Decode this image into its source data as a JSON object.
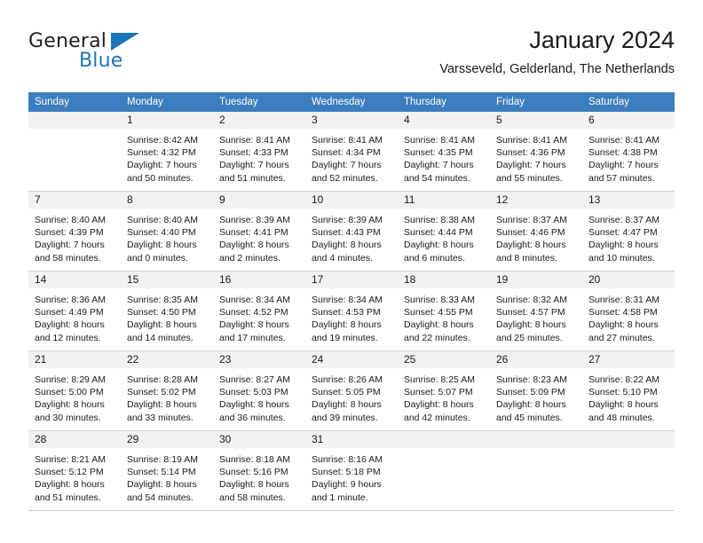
{
  "brand": {
    "name_part1": "General",
    "name_part2": "Blue",
    "triangle_icon": "triangle-icon",
    "accent_color": "#1b75bb"
  },
  "header": {
    "title": "January 2024",
    "subtitle": "Varsseveld, Gelderland, The Netherlands"
  },
  "calendar": {
    "header_bg": "#3b7dbf",
    "daynum_bg": "#f2f2f2",
    "weekdays": [
      "Sunday",
      "Monday",
      "Tuesday",
      "Wednesday",
      "Thursday",
      "Friday",
      "Saturday"
    ],
    "weeks": [
      [
        {
          "day": "",
          "lines": []
        },
        {
          "day": "1",
          "lines": [
            "Sunrise: 8:42 AM",
            "Sunset: 4:32 PM",
            "Daylight: 7 hours",
            "and 50 minutes."
          ]
        },
        {
          "day": "2",
          "lines": [
            "Sunrise: 8:41 AM",
            "Sunset: 4:33 PM",
            "Daylight: 7 hours",
            "and 51 minutes."
          ]
        },
        {
          "day": "3",
          "lines": [
            "Sunrise: 8:41 AM",
            "Sunset: 4:34 PM",
            "Daylight: 7 hours",
            "and 52 minutes."
          ]
        },
        {
          "day": "4",
          "lines": [
            "Sunrise: 8:41 AM",
            "Sunset: 4:35 PM",
            "Daylight: 7 hours",
            "and 54 minutes."
          ]
        },
        {
          "day": "5",
          "lines": [
            "Sunrise: 8:41 AM",
            "Sunset: 4:36 PM",
            "Daylight: 7 hours",
            "and 55 minutes."
          ]
        },
        {
          "day": "6",
          "lines": [
            "Sunrise: 8:41 AM",
            "Sunset: 4:38 PM",
            "Daylight: 7 hours",
            "and 57 minutes."
          ]
        }
      ],
      [
        {
          "day": "7",
          "lines": [
            "Sunrise: 8:40 AM",
            "Sunset: 4:39 PM",
            "Daylight: 7 hours",
            "and 58 minutes."
          ]
        },
        {
          "day": "8",
          "lines": [
            "Sunrise: 8:40 AM",
            "Sunset: 4:40 PM",
            "Daylight: 8 hours",
            "and 0 minutes."
          ]
        },
        {
          "day": "9",
          "lines": [
            "Sunrise: 8:39 AM",
            "Sunset: 4:41 PM",
            "Daylight: 8 hours",
            "and 2 minutes."
          ]
        },
        {
          "day": "10",
          "lines": [
            "Sunrise: 8:39 AM",
            "Sunset: 4:43 PM",
            "Daylight: 8 hours",
            "and 4 minutes."
          ]
        },
        {
          "day": "11",
          "lines": [
            "Sunrise: 8:38 AM",
            "Sunset: 4:44 PM",
            "Daylight: 8 hours",
            "and 6 minutes."
          ]
        },
        {
          "day": "12",
          "lines": [
            "Sunrise: 8:37 AM",
            "Sunset: 4:46 PM",
            "Daylight: 8 hours",
            "and 8 minutes."
          ]
        },
        {
          "day": "13",
          "lines": [
            "Sunrise: 8:37 AM",
            "Sunset: 4:47 PM",
            "Daylight: 8 hours",
            "and 10 minutes."
          ]
        }
      ],
      [
        {
          "day": "14",
          "lines": [
            "Sunrise: 8:36 AM",
            "Sunset: 4:49 PM",
            "Daylight: 8 hours",
            "and 12 minutes."
          ]
        },
        {
          "day": "15",
          "lines": [
            "Sunrise: 8:35 AM",
            "Sunset: 4:50 PM",
            "Daylight: 8 hours",
            "and 14 minutes."
          ]
        },
        {
          "day": "16",
          "lines": [
            "Sunrise: 8:34 AM",
            "Sunset: 4:52 PM",
            "Daylight: 8 hours",
            "and 17 minutes."
          ]
        },
        {
          "day": "17",
          "lines": [
            "Sunrise: 8:34 AM",
            "Sunset: 4:53 PM",
            "Daylight: 8 hours",
            "and 19 minutes."
          ]
        },
        {
          "day": "18",
          "lines": [
            "Sunrise: 8:33 AM",
            "Sunset: 4:55 PM",
            "Daylight: 8 hours",
            "and 22 minutes."
          ]
        },
        {
          "day": "19",
          "lines": [
            "Sunrise: 8:32 AM",
            "Sunset: 4:57 PM",
            "Daylight: 8 hours",
            "and 25 minutes."
          ]
        },
        {
          "day": "20",
          "lines": [
            "Sunrise: 8:31 AM",
            "Sunset: 4:58 PM",
            "Daylight: 8 hours",
            "and 27 minutes."
          ]
        }
      ],
      [
        {
          "day": "21",
          "lines": [
            "Sunrise: 8:29 AM",
            "Sunset: 5:00 PM",
            "Daylight: 8 hours",
            "and 30 minutes."
          ]
        },
        {
          "day": "22",
          "lines": [
            "Sunrise: 8:28 AM",
            "Sunset: 5:02 PM",
            "Daylight: 8 hours",
            "and 33 minutes."
          ]
        },
        {
          "day": "23",
          "lines": [
            "Sunrise: 8:27 AM",
            "Sunset: 5:03 PM",
            "Daylight: 8 hours",
            "and 36 minutes."
          ]
        },
        {
          "day": "24",
          "lines": [
            "Sunrise: 8:26 AM",
            "Sunset: 5:05 PM",
            "Daylight: 8 hours",
            "and 39 minutes."
          ]
        },
        {
          "day": "25",
          "lines": [
            "Sunrise: 8:25 AM",
            "Sunset: 5:07 PM",
            "Daylight: 8 hours",
            "and 42 minutes."
          ]
        },
        {
          "day": "26",
          "lines": [
            "Sunrise: 8:23 AM",
            "Sunset: 5:09 PM",
            "Daylight: 8 hours",
            "and 45 minutes."
          ]
        },
        {
          "day": "27",
          "lines": [
            "Sunrise: 8:22 AM",
            "Sunset: 5:10 PM",
            "Daylight: 8 hours",
            "and 48 minutes."
          ]
        }
      ],
      [
        {
          "day": "28",
          "lines": [
            "Sunrise: 8:21 AM",
            "Sunset: 5:12 PM",
            "Daylight: 8 hours",
            "and 51 minutes."
          ]
        },
        {
          "day": "29",
          "lines": [
            "Sunrise: 8:19 AM",
            "Sunset: 5:14 PM",
            "Daylight: 8 hours",
            "and 54 minutes."
          ]
        },
        {
          "day": "30",
          "lines": [
            "Sunrise: 8:18 AM",
            "Sunset: 5:16 PM",
            "Daylight: 8 hours",
            "and 58 minutes."
          ]
        },
        {
          "day": "31",
          "lines": [
            "Sunrise: 8:16 AM",
            "Sunset: 5:18 PM",
            "Daylight: 9 hours",
            "and 1 minute."
          ]
        },
        {
          "day": "",
          "lines": []
        },
        {
          "day": "",
          "lines": []
        },
        {
          "day": "",
          "lines": []
        }
      ]
    ]
  }
}
